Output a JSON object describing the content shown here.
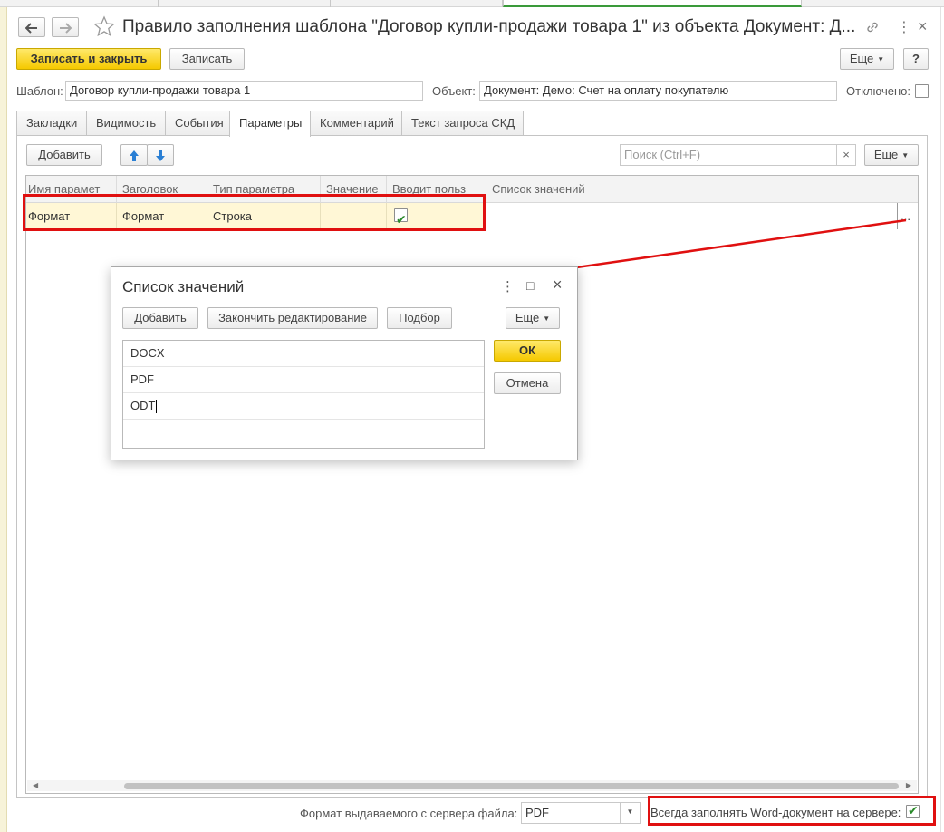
{
  "window": {
    "title": "Правило заполнения шаблона \"Договор купли-продажи товара 1\" из объекта Документ: Д...",
    "back_icon": "arrow-left-icon",
    "forward_icon": "arrow-right-icon",
    "star_icon": "star-icon",
    "link_icon": "link-icon",
    "more_icon": "more-vertical-icon",
    "close_icon": "close-icon",
    "more_glyph": "⋮",
    "close_glyph": "×"
  },
  "toolbar": {
    "save_close_label": "Записать и закрыть",
    "save_label": "Записать",
    "more_label": "Еще",
    "help_label": "?"
  },
  "header_fields": {
    "template_label": "Шаблон:",
    "template_value": "Договор купли-продажи товара 1",
    "object_label": "Объект:",
    "object_value": "Документ: Демо: Счет на оплату покупателю",
    "disabled_label": "Отключено:",
    "disabled_checked": false
  },
  "tabs": [
    {
      "label": "Закладки",
      "active": false
    },
    {
      "label": "Видимость",
      "active": false
    },
    {
      "label": "События",
      "active": false
    },
    {
      "label": "Параметры",
      "active": true
    },
    {
      "label": "Комментарий",
      "active": false
    },
    {
      "label": "Текст запроса СКД",
      "active": false
    }
  ],
  "params_toolbar": {
    "add_label": "Добавить",
    "search_placeholder": "Поиск (Ctrl+F)",
    "clear_glyph": "×",
    "more_label": "Еще"
  },
  "grid": {
    "columns": [
      "Имя парамет",
      "Заголовок",
      "Тип параметра",
      "Значение",
      "Вводит польз",
      "Список значений"
    ],
    "rows": [
      {
        "name": "Формат",
        "caption": "Формат",
        "type": "Строка",
        "value": "",
        "user_input": true,
        "value_list": "",
        "ellipsis": "..."
      }
    ]
  },
  "dialog": {
    "title": "Список значений",
    "add_label": "Добавить",
    "finish_edit_label": "Закончить редактирование",
    "pick_label": "Подбор",
    "more_label": "Еще",
    "ok_label": "ОК",
    "cancel_label": "Отмена",
    "items": [
      "DOCX",
      "PDF",
      "ODT"
    ],
    "more_glyph": "⋮",
    "maximize_glyph": "□",
    "close_glyph": "×"
  },
  "footer": {
    "format_label": "Формат выдаваемого с сервера файла:",
    "format_value": "PDF",
    "always_fill_label": "Всегда заполнять Word-документ на сервере:",
    "always_fill_checked": true
  },
  "colors": {
    "accent_yellow": "#f5c900",
    "annotation_red": "#e01010",
    "selected_row": "#fff7d6",
    "check_green": "#2a8a2a",
    "arrow_blue": "#2a7fd4"
  }
}
